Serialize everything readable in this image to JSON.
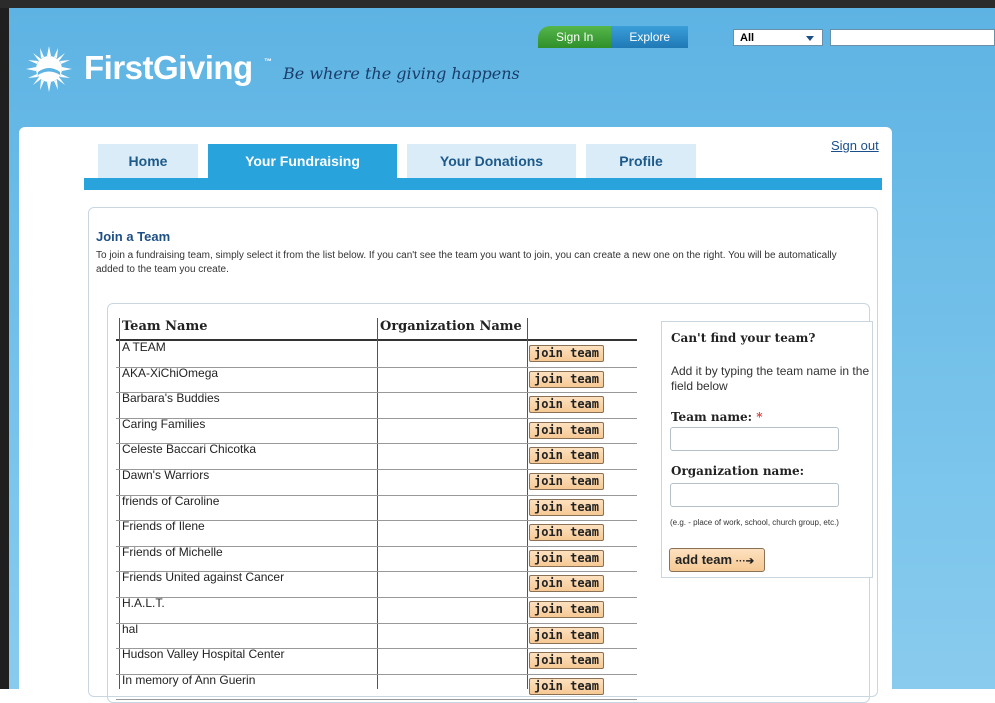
{
  "topnav": {
    "signin": "Sign In",
    "explore": "Explore",
    "scope_select": "All"
  },
  "brand": {
    "name": "FirstGiving",
    "trademark": "™",
    "tagline": "Be where the giving happens"
  },
  "header": {
    "signout": "Sign out"
  },
  "tabs": [
    {
      "label": "Home",
      "active": false
    },
    {
      "label": "Your Fundraising",
      "active": true
    },
    {
      "label": "Your Donations",
      "active": false
    },
    {
      "label": "Profile",
      "active": false
    }
  ],
  "section": {
    "title": "Join a Team",
    "description": "To join a fundraising team, simply select it from the list below. If you can't see the team you want to join, you can create a new one on the right. You will be automatically added to the team you create."
  },
  "table": {
    "columns": [
      "Team Name",
      "Organization Name",
      ""
    ],
    "join_label": "join team",
    "rows": [
      {
        "team": "A TEAM",
        "org": ""
      },
      {
        "team": "AKA-XiChiOmega",
        "org": ""
      },
      {
        "team": "Barbara's Buddies",
        "org": ""
      },
      {
        "team": "Caring Families",
        "org": ""
      },
      {
        "team": "Celeste Baccari Chicotka",
        "org": ""
      },
      {
        "team": "Dawn's Warriors",
        "org": ""
      },
      {
        "team": "friends of Caroline",
        "org": ""
      },
      {
        "team": "Friends of Ilene",
        "org": ""
      },
      {
        "team": "Friends of Michelle",
        "org": ""
      },
      {
        "team": "Friends United against Cancer",
        "org": ""
      },
      {
        "team": "H.A.L.T.",
        "org": ""
      },
      {
        "team": "hal",
        "org": ""
      },
      {
        "team": "Hudson Valley Hospital Center",
        "org": ""
      },
      {
        "team": "In memory of Ann Guerin",
        "org": ""
      }
    ]
  },
  "create_team": {
    "title": "Can't find your team?",
    "description": "Add it by typing the team name in the field below",
    "team_name_label": "Team name:",
    "required_mark": "*",
    "org_name_label": "Organization name:",
    "hint": "(e.g. - place of work, school, church group, etc.)",
    "add_label": "add team",
    "add_arrow": "···➔"
  },
  "colors": {
    "brand_blue": "#29a3dc",
    "tab_inactive": "#d9ecf8",
    "button_fill": "#f6c994",
    "signin_green": "#2f8f2a"
  }
}
